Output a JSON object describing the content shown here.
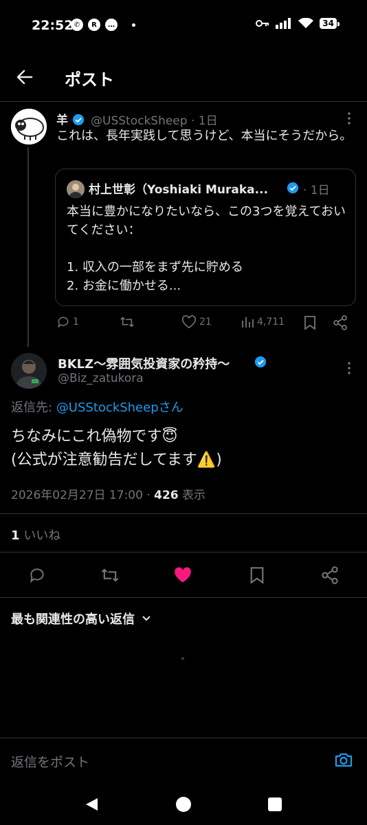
{
  "status_bar": {
    "time": "22:52",
    "battery": "34"
  },
  "header": {
    "title": "ポスト"
  },
  "original": {
    "name": "羊",
    "handle_time": "@USStockSheep · 1日",
    "text": "これは、長年実践して思うけど、本当にそうだから。",
    "quote": {
      "name": "村上世彰（Yoshiaki Muraka...",
      "time": "· 1日",
      "text": "本当に豊かになりたいなら、この3つを覚えておいてください：\n\n1. 収入の一部をまず先に貯める\n2. お金に働かせる..."
    },
    "counts": {
      "replies": "1",
      "reposts": "",
      "likes": "21",
      "views": "4,711"
    }
  },
  "reply": {
    "name": "BKLZ〜雰囲気投資家の矜持〜",
    "handle": "@Biz_zatukora",
    "reply_to_label": "返信先: ",
    "reply_to_link": "@USStockSheepさん",
    "text": "ちなみにこれ偽物です😇\n(公式が注意勧告だしてます⚠️)",
    "datetime": "2026年02月27日 17:00 · ",
    "views_count": "426",
    "views_label": " 表示",
    "likes_count": "1",
    "likes_label": " いいね"
  },
  "sort": {
    "label": "最も関連性の高い返信"
  },
  "composer": {
    "placeholder": "返信をポスト"
  },
  "colors": {
    "accent": "#1d9bf0",
    "like": "#f91880",
    "muted": "#71767b",
    "bg": "#000000"
  }
}
